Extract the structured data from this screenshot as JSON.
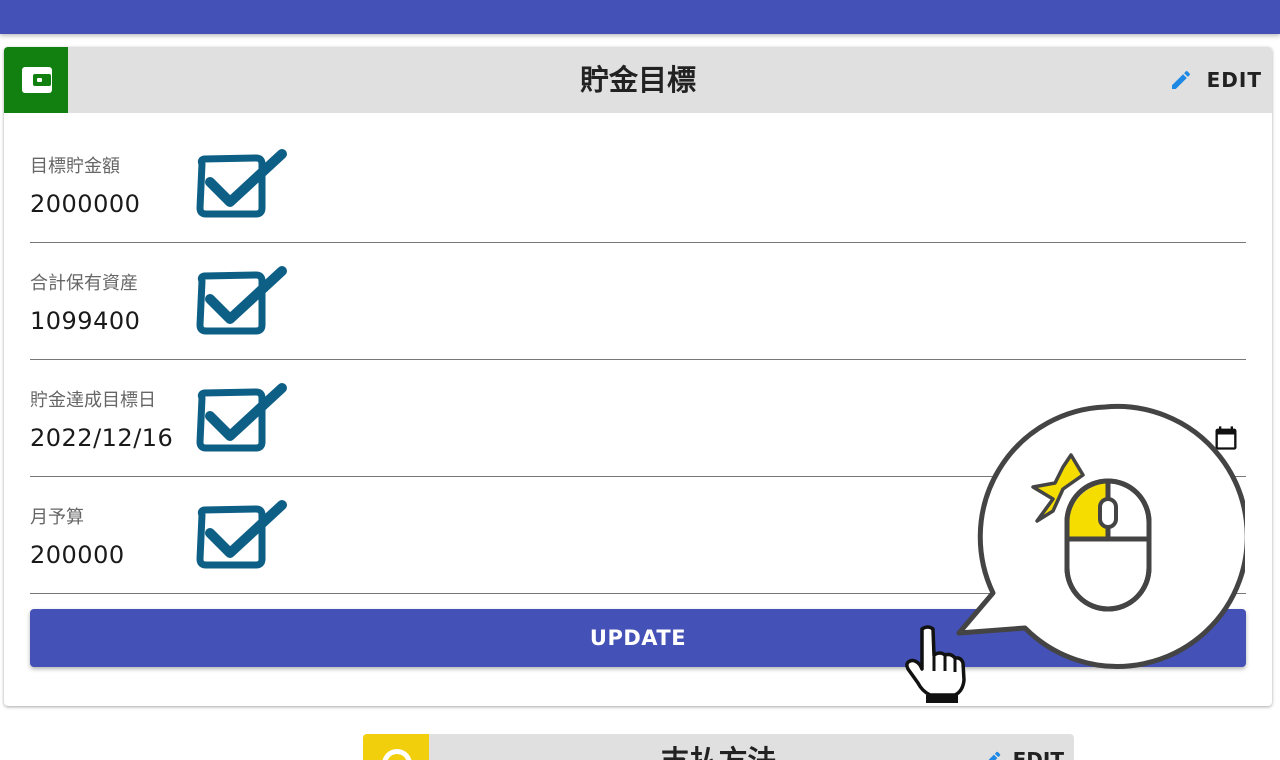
{
  "card": {
    "title": "貯金目標",
    "edit_label": "EDIT",
    "accent_color": "#118011"
  },
  "fields": [
    {
      "label": "目標貯金額",
      "value": "2000000"
    },
    {
      "label": "合計保有資産",
      "value": "1099400"
    },
    {
      "label": "貯金達成目標日",
      "value": "2022/12/16"
    },
    {
      "label": "月予算",
      "value": "200000"
    }
  ],
  "update_button": {
    "label": "UPDATE"
  },
  "next_card": {
    "title": "支払方法",
    "edit_label": "EDIT",
    "accent_color": "#f2cf0c"
  },
  "icons": {
    "wallet": "wallet-icon",
    "edit": "pencil-icon",
    "calendar": "calendar-icon",
    "check": "checkmark-icon",
    "mouse": "mouse-click-icon",
    "pointer": "hand-pointer-icon"
  },
  "colors": {
    "primary": "#4451b6",
    "header_bg": "#e0e0e0",
    "check": "#0e5f86",
    "edit_icon": "#1e88e5"
  }
}
